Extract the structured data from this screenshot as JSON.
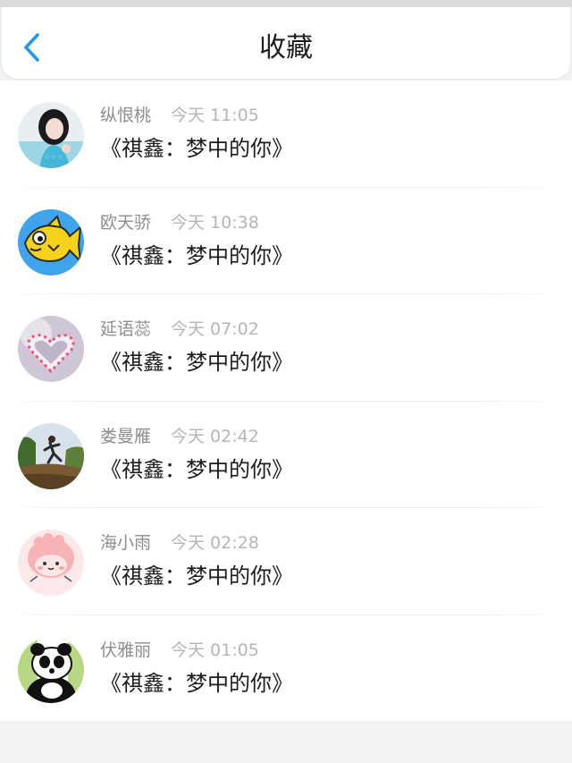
{
  "header": {
    "title": "收藏"
  },
  "icons": {
    "back": "chevron-left-icon"
  },
  "colors": {
    "accent": "#2196f3",
    "title": "#1e1e1e",
    "name": "#8d8d8d",
    "time": "#b5b5b5"
  },
  "favorites": [
    {
      "name": "纵恨桃",
      "time": "今天 11:05",
      "message": "《祺鑫：梦中的你》"
    },
    {
      "name": "欧天骄",
      "time": "今天 10:38",
      "message": "《祺鑫：梦中的你》"
    },
    {
      "name": "延语蕊",
      "time": "今天 07:02",
      "message": "《祺鑫：梦中的你》"
    },
    {
      "name": "娄曼雁",
      "time": "今天 02:42",
      "message": "《祺鑫：梦中的你》"
    },
    {
      "name": "海小雨",
      "time": "今天 02:28",
      "message": "《祺鑫：梦中的你》"
    },
    {
      "name": "伏雅丽",
      "time": "今天 01:05",
      "message": "《祺鑫：梦中的你》"
    }
  ]
}
